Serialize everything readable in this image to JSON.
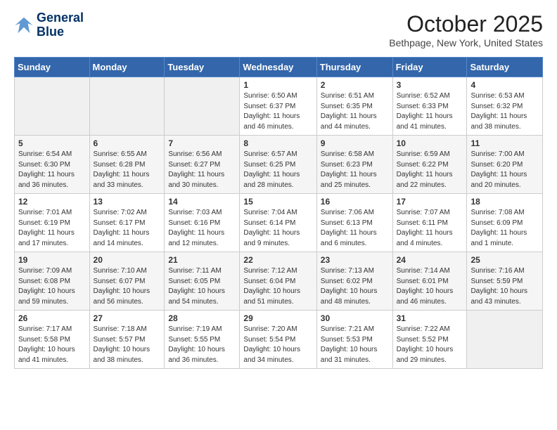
{
  "header": {
    "logo": {
      "line1": "General",
      "line2": "Blue"
    },
    "title": "October 2025",
    "location": "Bethpage, New York, United States"
  },
  "weekdays": [
    "Sunday",
    "Monday",
    "Tuesday",
    "Wednesday",
    "Thursday",
    "Friday",
    "Saturday"
  ],
  "weeks": [
    [
      {
        "day": "",
        "info": ""
      },
      {
        "day": "",
        "info": ""
      },
      {
        "day": "",
        "info": ""
      },
      {
        "day": "1",
        "info": "Sunrise: 6:50 AM\nSunset: 6:37 PM\nDaylight: 11 hours\nand 46 minutes."
      },
      {
        "day": "2",
        "info": "Sunrise: 6:51 AM\nSunset: 6:35 PM\nDaylight: 11 hours\nand 44 minutes."
      },
      {
        "day": "3",
        "info": "Sunrise: 6:52 AM\nSunset: 6:33 PM\nDaylight: 11 hours\nand 41 minutes."
      },
      {
        "day": "4",
        "info": "Sunrise: 6:53 AM\nSunset: 6:32 PM\nDaylight: 11 hours\nand 38 minutes."
      }
    ],
    [
      {
        "day": "5",
        "info": "Sunrise: 6:54 AM\nSunset: 6:30 PM\nDaylight: 11 hours\nand 36 minutes."
      },
      {
        "day": "6",
        "info": "Sunrise: 6:55 AM\nSunset: 6:28 PM\nDaylight: 11 hours\nand 33 minutes."
      },
      {
        "day": "7",
        "info": "Sunrise: 6:56 AM\nSunset: 6:27 PM\nDaylight: 11 hours\nand 30 minutes."
      },
      {
        "day": "8",
        "info": "Sunrise: 6:57 AM\nSunset: 6:25 PM\nDaylight: 11 hours\nand 28 minutes."
      },
      {
        "day": "9",
        "info": "Sunrise: 6:58 AM\nSunset: 6:23 PM\nDaylight: 11 hours\nand 25 minutes."
      },
      {
        "day": "10",
        "info": "Sunrise: 6:59 AM\nSunset: 6:22 PM\nDaylight: 11 hours\nand 22 minutes."
      },
      {
        "day": "11",
        "info": "Sunrise: 7:00 AM\nSunset: 6:20 PM\nDaylight: 11 hours\nand 20 minutes."
      }
    ],
    [
      {
        "day": "12",
        "info": "Sunrise: 7:01 AM\nSunset: 6:19 PM\nDaylight: 11 hours\nand 17 minutes."
      },
      {
        "day": "13",
        "info": "Sunrise: 7:02 AM\nSunset: 6:17 PM\nDaylight: 11 hours\nand 14 minutes."
      },
      {
        "day": "14",
        "info": "Sunrise: 7:03 AM\nSunset: 6:16 PM\nDaylight: 11 hours\nand 12 minutes."
      },
      {
        "day": "15",
        "info": "Sunrise: 7:04 AM\nSunset: 6:14 PM\nDaylight: 11 hours\nand 9 minutes."
      },
      {
        "day": "16",
        "info": "Sunrise: 7:06 AM\nSunset: 6:13 PM\nDaylight: 11 hours\nand 6 minutes."
      },
      {
        "day": "17",
        "info": "Sunrise: 7:07 AM\nSunset: 6:11 PM\nDaylight: 11 hours\nand 4 minutes."
      },
      {
        "day": "18",
        "info": "Sunrise: 7:08 AM\nSunset: 6:09 PM\nDaylight: 11 hours\nand 1 minute."
      }
    ],
    [
      {
        "day": "19",
        "info": "Sunrise: 7:09 AM\nSunset: 6:08 PM\nDaylight: 10 hours\nand 59 minutes."
      },
      {
        "day": "20",
        "info": "Sunrise: 7:10 AM\nSunset: 6:07 PM\nDaylight: 10 hours\nand 56 minutes."
      },
      {
        "day": "21",
        "info": "Sunrise: 7:11 AM\nSunset: 6:05 PM\nDaylight: 10 hours\nand 54 minutes."
      },
      {
        "day": "22",
        "info": "Sunrise: 7:12 AM\nSunset: 6:04 PM\nDaylight: 10 hours\nand 51 minutes."
      },
      {
        "day": "23",
        "info": "Sunrise: 7:13 AM\nSunset: 6:02 PM\nDaylight: 10 hours\nand 48 minutes."
      },
      {
        "day": "24",
        "info": "Sunrise: 7:14 AM\nSunset: 6:01 PM\nDaylight: 10 hours\nand 46 minutes."
      },
      {
        "day": "25",
        "info": "Sunrise: 7:16 AM\nSunset: 5:59 PM\nDaylight: 10 hours\nand 43 minutes."
      }
    ],
    [
      {
        "day": "26",
        "info": "Sunrise: 7:17 AM\nSunset: 5:58 PM\nDaylight: 10 hours\nand 41 minutes."
      },
      {
        "day": "27",
        "info": "Sunrise: 7:18 AM\nSunset: 5:57 PM\nDaylight: 10 hours\nand 38 minutes."
      },
      {
        "day": "28",
        "info": "Sunrise: 7:19 AM\nSunset: 5:55 PM\nDaylight: 10 hours\nand 36 minutes."
      },
      {
        "day": "29",
        "info": "Sunrise: 7:20 AM\nSunset: 5:54 PM\nDaylight: 10 hours\nand 34 minutes."
      },
      {
        "day": "30",
        "info": "Sunrise: 7:21 AM\nSunset: 5:53 PM\nDaylight: 10 hours\nand 31 minutes."
      },
      {
        "day": "31",
        "info": "Sunrise: 7:22 AM\nSunset: 5:52 PM\nDaylight: 10 hours\nand 29 minutes."
      },
      {
        "day": "",
        "info": ""
      }
    ]
  ]
}
